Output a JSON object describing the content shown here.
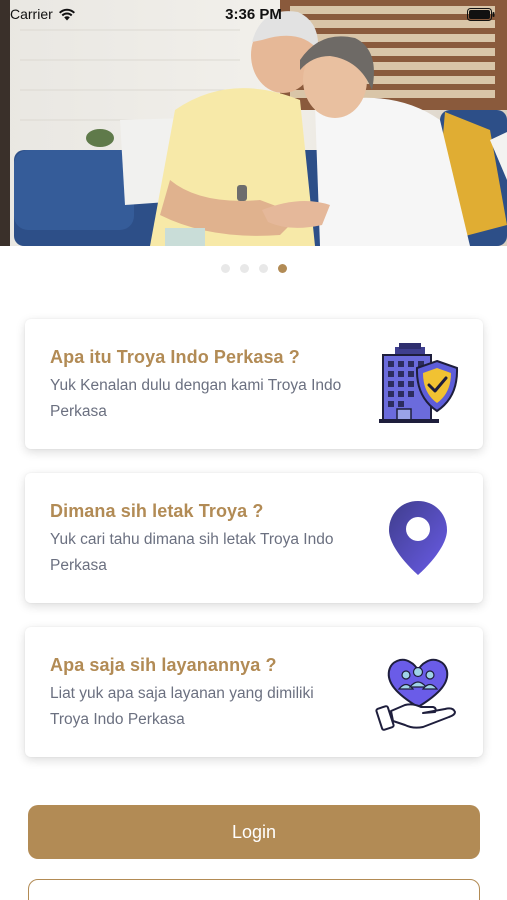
{
  "status_bar": {
    "carrier": "Carrier",
    "time": "3:36 PM"
  },
  "hero": {
    "image_alt": "Elderly couple embracing on a sofa",
    "page_count": 4,
    "active_page": 4
  },
  "cards": [
    {
      "title": "Apa itu Troya Indo Perkasa ?",
      "description": "Yuk Kenalan dulu dengan kami Troya Indo Perkasa",
      "icon": "building-shield-icon"
    },
    {
      "title": "Dimana sih letak Troya ?",
      "description": "Yuk cari tahu dimana sih letak Troya Indo Perkasa",
      "icon": "location-pin-icon"
    },
    {
      "title": "Apa saja sih layanannya ?",
      "description": "Liat yuk apa saja layanan yang dimiliki Troya Indo Perkasa",
      "icon": "hand-heart-people-icon"
    }
  ],
  "buttons": {
    "login": "Login",
    "secondary": ""
  },
  "colors": {
    "brand": "#b28b55",
    "text_muted": "#6b7080",
    "icon_purple": "#5c5cd6"
  }
}
